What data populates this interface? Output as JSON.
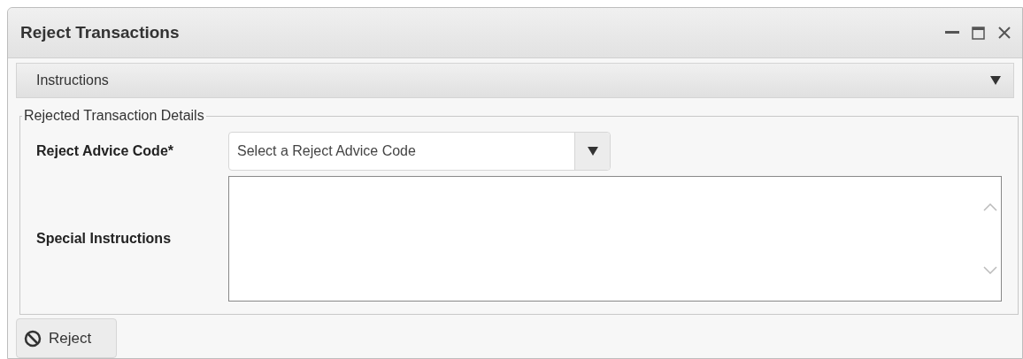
{
  "window": {
    "title": "Reject Transactions"
  },
  "instructions_panel": {
    "label": "Instructions"
  },
  "fieldset": {
    "legend": "Rejected Transaction Details",
    "fields": [
      {
        "kind": "select",
        "label": "Reject Advice Code*",
        "placeholder": "Select a Reject Advice Code"
      },
      {
        "kind": "textarea",
        "label": "Special Instructions"
      }
    ]
  },
  "buttons": [
    {
      "label": "Reject"
    }
  ]
}
